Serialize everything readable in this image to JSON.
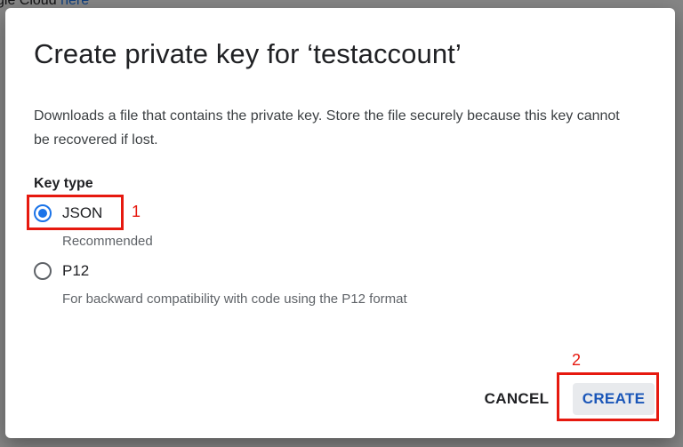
{
  "background": {
    "top_text": "gle Cloud",
    "top_link": "here"
  },
  "dialog": {
    "title": "Create private key for ‘testaccount’",
    "description": "Downloads a file that contains the private key. Store the file securely because this key cannot be recovered if lost.",
    "key_type_label": "Key type",
    "options": [
      {
        "label": "JSON",
        "sublabel": "Recommended",
        "selected": true
      },
      {
        "label": "P12",
        "sublabel": "For backward compatibility with code using the P12 format",
        "selected": false
      }
    ],
    "cancel_label": "CANCEL",
    "create_label": "CREATE"
  },
  "annotations": {
    "step1": "1",
    "step2": "2",
    "color": "#e6190f"
  },
  "colors": {
    "accent": "#1a73e8",
    "create_text": "#1a56b8",
    "create_bg": "#e8eaed"
  }
}
